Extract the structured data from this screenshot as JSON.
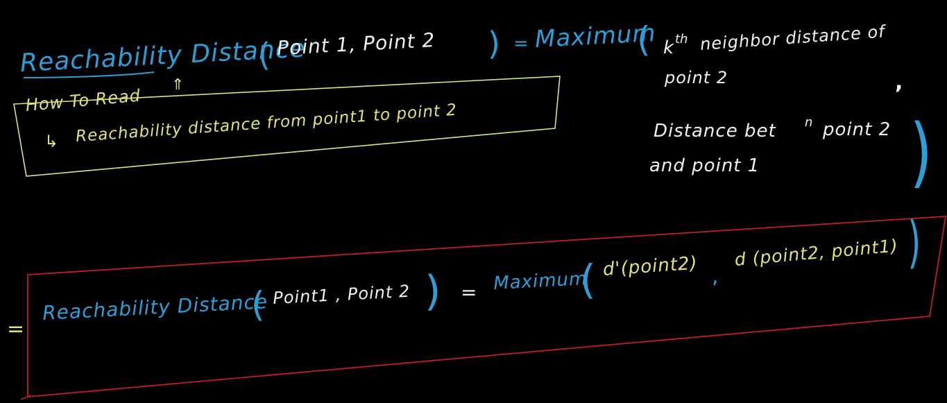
{
  "colors": {
    "background": "#000000",
    "blue_ink": "#2e9fd6",
    "white_ink": "#f2f2f2",
    "yellow_ink": "#e4e37a",
    "red_box": "#c0202a"
  },
  "definition": {
    "lhs_term": "Reachability Distance",
    "lhs_open_paren": "(",
    "lhs_args": "Point 1,  Point 2",
    "lhs_close_paren": ")",
    "equals": "=",
    "maximum": "Maximum",
    "open_paren": "(",
    "kth_k": "k",
    "kth_th": "th",
    "first_arg_line1": "neighbor distance of",
    "first_arg_line2": "point 2",
    "comma": ",",
    "second_arg_line1": "Distance bet",
    "second_arg_n": "n",
    "second_arg_line1_end": "point 2",
    "second_arg_line2": "and  point 1",
    "close_paren": ")"
  },
  "how_to_read": {
    "title": "How To Read",
    "arrow": "⇑",
    "explanation_arrow": "↳",
    "explanation": "Reachability  distance  from  point1  to  point 2"
  },
  "formula": {
    "equals": "=",
    "lhs_term": "Reachability Distance",
    "lhs_open_paren": "(",
    "lhs_args": "Point1 ,  Point 2",
    "lhs_close_paren": ")",
    "rhs_equals": "=",
    "maximum": "Maximum",
    "open_paren": "(",
    "arg1": "d'(point2)",
    "comma": ",",
    "arg2": "d (point2,  point1)",
    "close_paren": ")"
  }
}
